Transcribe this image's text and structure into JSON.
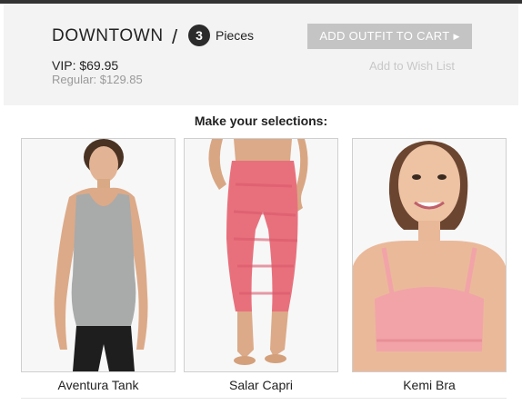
{
  "outfit": {
    "name": "DOWNTOWN",
    "separator": "/",
    "piece_count": "3",
    "pieces_label": "Pieces",
    "vip_price": "VIP: $69.95",
    "regular_price": "Regular: $129.85"
  },
  "actions": {
    "add_to_cart_label": "ADD OUTFIT TO CART",
    "add_to_cart_arrow": "▶",
    "wishlist_label": "Add to Wish List"
  },
  "selection_heading": "Make your selections:",
  "products": [
    {
      "name": "Aventura Tank"
    },
    {
      "name": "Salar Capri"
    },
    {
      "name": "Kemi Bra"
    }
  ],
  "colors": {
    "header_bg": "#f3f3f3",
    "button_bg": "#c4c4c4",
    "tank": "#a9aaaa",
    "capri": "#e8707c",
    "bra": "#f2a3a8"
  }
}
